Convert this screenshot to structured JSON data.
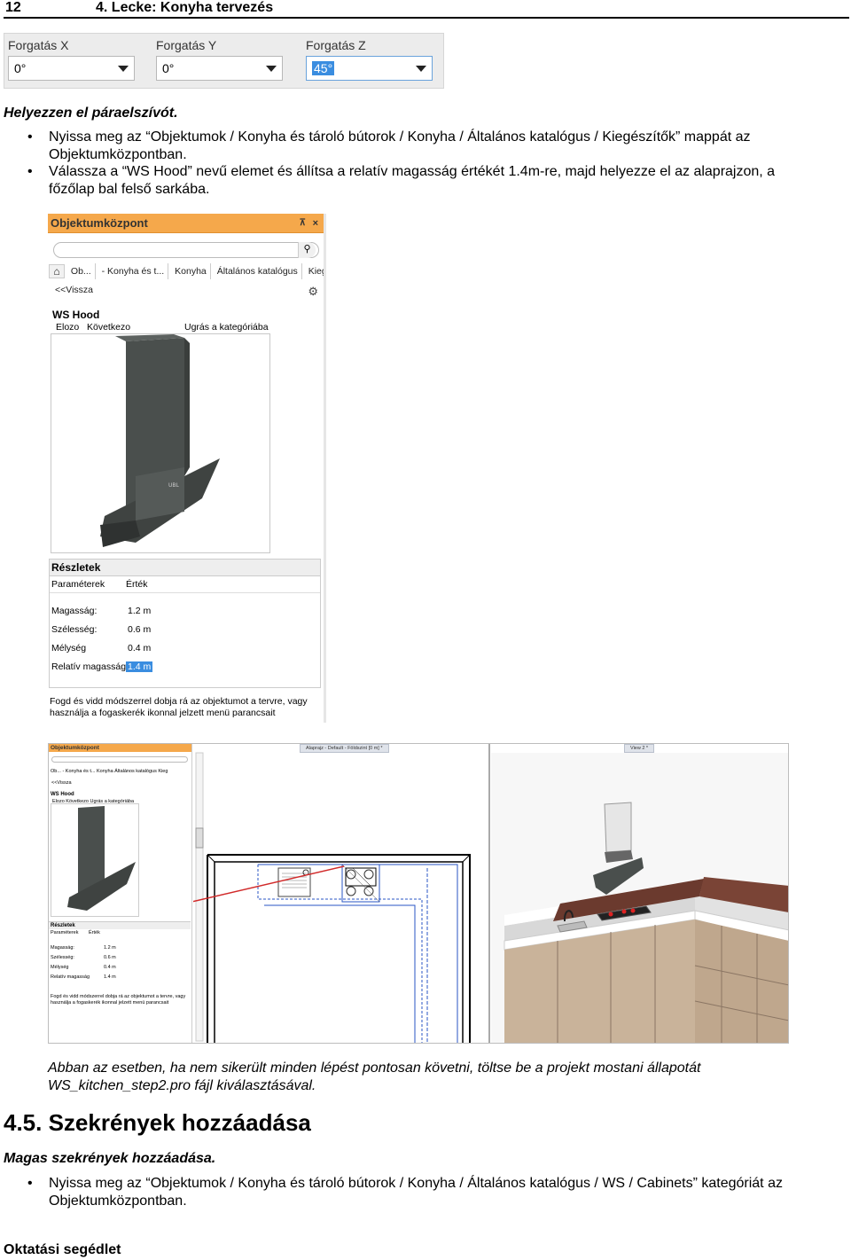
{
  "header": {
    "page_number": "12",
    "chapter": "4. Lecke: Konyha tervezés"
  },
  "rotation_panel": {
    "fields": [
      {
        "label": "Forgatás X",
        "value": "0°"
      },
      {
        "label": "Forgatás Y",
        "value": "0°"
      },
      {
        "label": "Forgatás Z",
        "value": "45°"
      }
    ]
  },
  "section1": {
    "heading": "Helyezzen el páraelszívót.",
    "bullets": [
      "Nyissa meg az “Objektumok / Konyha és tároló bútorok / Konyha / Általános katalógus / Kiegészítők” mappát az Objektumközpontban.",
      "Válassza a “WS Hood” nevű elemet és állítsa a relatív magasság értékét 1.4m-re, majd helyezze el az alaprajzon, a főzőlap bal felső sarkába."
    ]
  },
  "object_center": {
    "title": "Objektumközpont",
    "pin_icon": "⊼",
    "close_icon": "×",
    "breadcrumbs": [
      "Ob...",
      "- Konyha és t...",
      "Konyha",
      "Általános katalógus",
      "Kieg"
    ],
    "back_label": "<<Vissza",
    "item_name": "WS Hood",
    "nav": {
      "prev": "Elozo",
      "next": "Következo",
      "jump": "Ugrás a kategóriába"
    },
    "details": {
      "heading": "Részletek",
      "col_params": "Paraméterek",
      "col_value": "Érték",
      "rows": [
        {
          "label": "Magasság:",
          "value": "1.2 m"
        },
        {
          "label": "Szélesség:",
          "value": "0.6 m"
        },
        {
          "label": "Mélység",
          "value": "0.4 m"
        },
        {
          "label": "Relatív magasság",
          "value": "1.4 m"
        }
      ]
    },
    "hint": "Fogd és vidd módszerrel dobja rá az objektumot a tervre, vagy használja a fogaskerék ikonnal jelzett menü parancsait"
  },
  "composite": {
    "mini_panel": {
      "title": "Objektumközpont",
      "breadcrumbs": "Ob... - Konyha és t... Konyha Általános katalógus Kieg",
      "back_label": "<<Vissza",
      "item_name": "WS Hood",
      "nav": "Elozo   Következo            Ugrás a kategóriába",
      "details_heading": "Részletek",
      "col_params": "Paraméterek",
      "col_value": "Érték",
      "rows": [
        {
          "label": "Magasság:",
          "value": "1.2 m"
        },
        {
          "label": "Szélesség:",
          "value": "0.6 m"
        },
        {
          "label": "Mélység",
          "value": "0.4 m"
        },
        {
          "label": "Relatív magasság",
          "value": "1.4 m"
        }
      ],
      "hint": "Fogd és vidd módszerrel dobja rá az objektumot a tervre, vagy használja a fogaskerék ikonnal jelzett menü parancsait"
    },
    "plan_tab": "Alaprajz - Default - Földszint [0 m] *",
    "view_tab": "View 2 *"
  },
  "note": "Abban az esetben, ha nem sikerült minden lépést pontosan követni, töltse be a projekt mostani állapotát WS_kitchen_step2.pro fájl kiválasztásával.",
  "section2": {
    "number_title": "4.5. Szekrények hozzáadása",
    "heading": "Magas szekrények hozzáadása.",
    "bullets": [
      "Nyissa meg az “Objektumok / Konyha és tároló bútorok / Konyha / Általános katalógus / WS / Cabinets” kategóriát az Objektumközpontban."
    ]
  },
  "footer": "Oktatási segédlet"
}
